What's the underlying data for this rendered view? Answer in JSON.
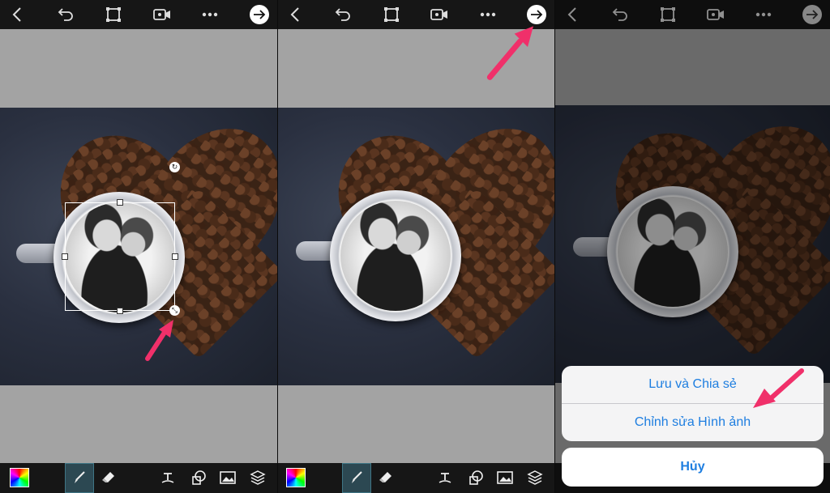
{
  "panels": [
    {
      "topbar": {
        "back_icon": "chevron-left-icon",
        "undo_icon": "undo-icon",
        "crop_icon": "crop-icon",
        "video_icon": "video-camera-icon",
        "more_icon": "more-horizontal-icon",
        "next_icon": "arrow-right-circle-icon"
      },
      "bottombar": {
        "color_icon": "color-picker-icon",
        "brush_icon": "brush-icon",
        "eraser_icon": "eraser-icon",
        "text_icon": "text-icon",
        "sticker_icon": "sticker-icon",
        "image_icon": "image-icon",
        "layers_icon": "layers-icon"
      }
    },
    {
      "topbar": {
        "back_icon": "chevron-left-icon",
        "undo_icon": "undo-icon",
        "crop_icon": "crop-icon",
        "video_icon": "video-camera-icon",
        "more_icon": "more-horizontal-icon",
        "next_icon": "arrow-right-circle-icon"
      },
      "bottombar": {
        "color_icon": "color-picker-icon",
        "brush_icon": "brush-icon",
        "eraser_icon": "eraser-icon",
        "text_icon": "text-icon",
        "sticker_icon": "sticker-icon",
        "image_icon": "image-icon",
        "layers_icon": "layers-icon"
      }
    },
    {
      "topbar": {
        "back_icon": "chevron-left-icon",
        "undo_icon": "undo-icon",
        "crop_icon": "crop-icon",
        "video_icon": "video-camera-icon",
        "more_icon": "more-horizontal-icon",
        "next_icon": "arrow-right-circle-icon"
      },
      "action_sheet": {
        "save_share": "Lưu và Chia sẻ",
        "edit_image": "Chỉnh sửa Hình ảnh",
        "cancel": "Hủy"
      }
    }
  ],
  "colors": {
    "topbar_bg": "#161616",
    "canvas_bg": "#a3a3a3",
    "accent_blue": "#1e7ee0",
    "arrow_pink": "#f0306a",
    "selected_tool_bg": "#2c4852"
  }
}
